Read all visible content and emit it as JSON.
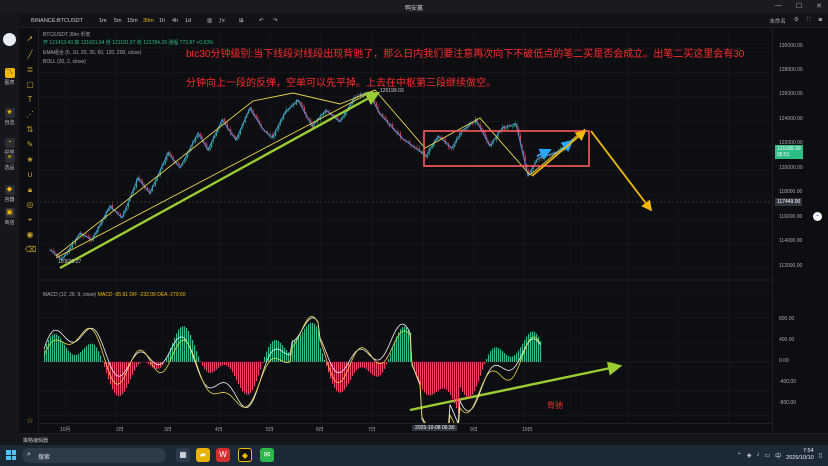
{
  "window": {
    "title": "鸭安赢",
    "controls": [
      "—",
      "☐",
      "✕"
    ]
  },
  "toolbar": {
    "symbol": "BINANCE:BTCUSDT",
    "timeframes": [
      "1m",
      "5m",
      "15m",
      "30m",
      "1h",
      "4h",
      "1d"
    ],
    "active_timeframe": "30m",
    "right_label": "未命名"
  },
  "sidebar": {
    "items": [
      {
        "label": "图表",
        "icon": "chart-icon"
      },
      {
        "label": "自选",
        "icon": "star-icon"
      },
      {
        "label": "提醒",
        "icon": "bell-icon"
      },
      {
        "label": "选品",
        "icon": "list-icon"
      },
      {
        "label": "容器",
        "icon": "diamond-icon"
      },
      {
        "label": "商店",
        "icon": "store-icon"
      }
    ]
  },
  "legend": {
    "main": "BTC/USDT  30m  币安",
    "ohlc": "开 121413.43  高 121631.54  低 121191.57  收 121784.29  涨幅 772.87 +0.63%",
    "ema": "EMA组合 (5, 10, 20, 30, 60, 120, 200, close)",
    "boll": "BOLL (20, 2, close)",
    "macd_name": "MACD (12, 26, 9, close)",
    "macd_vals": "MACD -95.91  DIF -232.09  DEA -279.60"
  },
  "annotations": {
    "main_text_line1": "btc30分钟级别:当下线段对线段出现背驰了，那么日内我们要注意再次向下不破低点的笔二买是否会成立。出笔二买这里会有30",
    "main_text_line2": "分钟向上一段的反弹，空单可以先平掉。上去在中枢第三段继续做空。",
    "divergence_label": "背驰",
    "high_label": "126199.03",
    "low_label": "110636.27"
  },
  "price_axis": {
    "ticks": [
      "130000.00",
      "128000.00",
      "126000.00",
      "124000.00",
      "122000.00",
      "120000.00",
      "118000.00",
      "116000.00",
      "114000.00",
      "112000.00"
    ],
    "current_price": "121099.99",
    "countdown": "05:51",
    "crosshair_price": "117449.00"
  },
  "macd_axis": {
    "ticks": [
      "800.00",
      "400.00",
      "0.00",
      "-400.00",
      "-800.00"
    ]
  },
  "time_axis": {
    "ticks": [
      "10月",
      "2日",
      "3日",
      "4日",
      "5日",
      "6日",
      "7日",
      "9日",
      "10日"
    ],
    "highlight": "2025-10-08 06:30"
  },
  "footer": {
    "label": "策略编辑器"
  },
  "taskbar": {
    "search_placeholder": "搜索",
    "time": "7:54",
    "date": "2025/10/10"
  },
  "colors": {
    "accent": "#f0b90b",
    "up": "#2ebd85",
    "down": "#f6465d",
    "annotation": "#ff2b2b"
  }
}
